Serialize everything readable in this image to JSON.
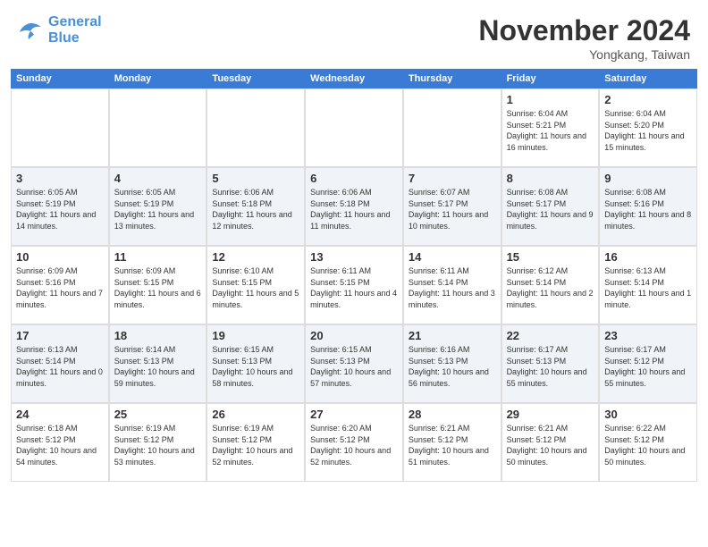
{
  "header": {
    "logo_text1": "General",
    "logo_text2": "Blue",
    "month": "November 2024",
    "location": "Yongkang, Taiwan"
  },
  "calendar": {
    "days_of_week": [
      "Sunday",
      "Monday",
      "Tuesday",
      "Wednesday",
      "Thursday",
      "Friday",
      "Saturday"
    ],
    "rows": [
      [
        {
          "num": "",
          "info": ""
        },
        {
          "num": "",
          "info": ""
        },
        {
          "num": "",
          "info": ""
        },
        {
          "num": "",
          "info": ""
        },
        {
          "num": "",
          "info": ""
        },
        {
          "num": "1",
          "info": "Sunrise: 6:04 AM\nSunset: 5:21 PM\nDaylight: 11 hours\nand 16 minutes."
        },
        {
          "num": "2",
          "info": "Sunrise: 6:04 AM\nSunset: 5:20 PM\nDaylight: 11 hours\nand 15 minutes."
        }
      ],
      [
        {
          "num": "3",
          "info": "Sunrise: 6:05 AM\nSunset: 5:19 PM\nDaylight: 11 hours\nand 14 minutes."
        },
        {
          "num": "4",
          "info": "Sunrise: 6:05 AM\nSunset: 5:19 PM\nDaylight: 11 hours\nand 13 minutes."
        },
        {
          "num": "5",
          "info": "Sunrise: 6:06 AM\nSunset: 5:18 PM\nDaylight: 11 hours\nand 12 minutes."
        },
        {
          "num": "6",
          "info": "Sunrise: 6:06 AM\nSunset: 5:18 PM\nDaylight: 11 hours\nand 11 minutes."
        },
        {
          "num": "7",
          "info": "Sunrise: 6:07 AM\nSunset: 5:17 PM\nDaylight: 11 hours\nand 10 minutes."
        },
        {
          "num": "8",
          "info": "Sunrise: 6:08 AM\nSunset: 5:17 PM\nDaylight: 11 hours\nand 9 minutes."
        },
        {
          "num": "9",
          "info": "Sunrise: 6:08 AM\nSunset: 5:16 PM\nDaylight: 11 hours\nand 8 minutes."
        }
      ],
      [
        {
          "num": "10",
          "info": "Sunrise: 6:09 AM\nSunset: 5:16 PM\nDaylight: 11 hours\nand 7 minutes."
        },
        {
          "num": "11",
          "info": "Sunrise: 6:09 AM\nSunset: 5:15 PM\nDaylight: 11 hours\nand 6 minutes."
        },
        {
          "num": "12",
          "info": "Sunrise: 6:10 AM\nSunset: 5:15 PM\nDaylight: 11 hours\nand 5 minutes."
        },
        {
          "num": "13",
          "info": "Sunrise: 6:11 AM\nSunset: 5:15 PM\nDaylight: 11 hours\nand 4 minutes."
        },
        {
          "num": "14",
          "info": "Sunrise: 6:11 AM\nSunset: 5:14 PM\nDaylight: 11 hours\nand 3 minutes."
        },
        {
          "num": "15",
          "info": "Sunrise: 6:12 AM\nSunset: 5:14 PM\nDaylight: 11 hours\nand 2 minutes."
        },
        {
          "num": "16",
          "info": "Sunrise: 6:13 AM\nSunset: 5:14 PM\nDaylight: 11 hours\nand 1 minute."
        }
      ],
      [
        {
          "num": "17",
          "info": "Sunrise: 6:13 AM\nSunset: 5:14 PM\nDaylight: 11 hours\nand 0 minutes."
        },
        {
          "num": "18",
          "info": "Sunrise: 6:14 AM\nSunset: 5:13 PM\nDaylight: 10 hours\nand 59 minutes."
        },
        {
          "num": "19",
          "info": "Sunrise: 6:15 AM\nSunset: 5:13 PM\nDaylight: 10 hours\nand 58 minutes."
        },
        {
          "num": "20",
          "info": "Sunrise: 6:15 AM\nSunset: 5:13 PM\nDaylight: 10 hours\nand 57 minutes."
        },
        {
          "num": "21",
          "info": "Sunrise: 6:16 AM\nSunset: 5:13 PM\nDaylight: 10 hours\nand 56 minutes."
        },
        {
          "num": "22",
          "info": "Sunrise: 6:17 AM\nSunset: 5:13 PM\nDaylight: 10 hours\nand 55 minutes."
        },
        {
          "num": "23",
          "info": "Sunrise: 6:17 AM\nSunset: 5:12 PM\nDaylight: 10 hours\nand 55 minutes."
        }
      ],
      [
        {
          "num": "24",
          "info": "Sunrise: 6:18 AM\nSunset: 5:12 PM\nDaylight: 10 hours\nand 54 minutes."
        },
        {
          "num": "25",
          "info": "Sunrise: 6:19 AM\nSunset: 5:12 PM\nDaylight: 10 hours\nand 53 minutes."
        },
        {
          "num": "26",
          "info": "Sunrise: 6:19 AM\nSunset: 5:12 PM\nDaylight: 10 hours\nand 52 minutes."
        },
        {
          "num": "27",
          "info": "Sunrise: 6:20 AM\nSunset: 5:12 PM\nDaylight: 10 hours\nand 52 minutes."
        },
        {
          "num": "28",
          "info": "Sunrise: 6:21 AM\nSunset: 5:12 PM\nDaylight: 10 hours\nand 51 minutes."
        },
        {
          "num": "29",
          "info": "Sunrise: 6:21 AM\nSunset: 5:12 PM\nDaylight: 10 hours\nand 50 minutes."
        },
        {
          "num": "30",
          "info": "Sunrise: 6:22 AM\nSunset: 5:12 PM\nDaylight: 10 hours\nand 50 minutes."
        }
      ]
    ]
  }
}
